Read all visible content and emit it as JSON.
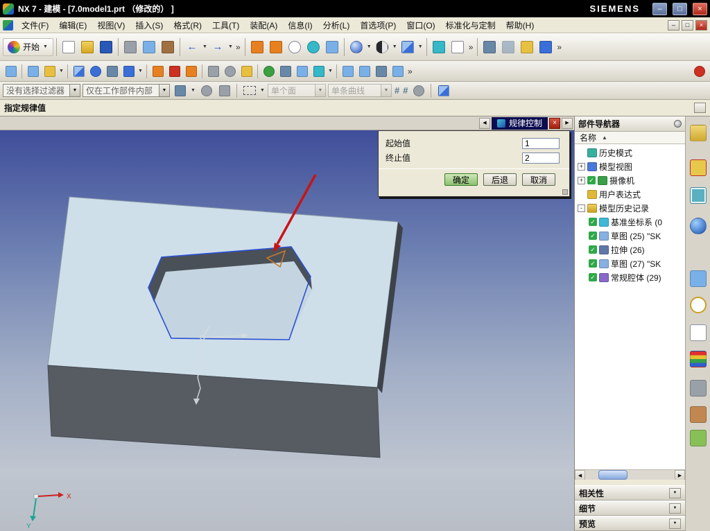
{
  "window": {
    "title": "NX 7 - 建模 - [7.0model1.prt （修改的） ]",
    "brand": "SIEMENS",
    "min": "–",
    "max": "□",
    "close": "×"
  },
  "menu": {
    "items": [
      "文件(F)",
      "编辑(E)",
      "视图(V)",
      "插入(S)",
      "格式(R)",
      "工具(T)",
      "装配(A)",
      "信息(I)",
      "分析(L)",
      "首选项(P)",
      "窗口(O)",
      "标准化与定制",
      "帮助(H)"
    ]
  },
  "toolbar": {
    "start_label": "开始",
    "dropdown_glyph": "▼",
    "overflow_glyph": "»",
    "undo_glyph": "←",
    "redo_glyph": "→"
  },
  "selection_bar": {
    "filter": "没有选择过滤器",
    "scope": "仅在工作部件内部",
    "rule_face": "单个面",
    "rule_curve": "单条曲线",
    "grid_glyph": "#"
  },
  "prompt": {
    "text": "指定规律值"
  },
  "dialog": {
    "title": "规律控制",
    "prev": "◀",
    "next": "▶",
    "close": "×",
    "fields": [
      {
        "label": "起始值",
        "value": "1"
      },
      {
        "label": "终止值",
        "value": "2"
      }
    ],
    "buttons": {
      "ok": "确定",
      "back": "后退",
      "cancel": "取消"
    }
  },
  "navigator": {
    "title": "部件导航器",
    "column_name": "名称",
    "sort_glyph": "▲",
    "scroll_left": "◀",
    "scroll_right": "▶",
    "section_glyph": "▼",
    "items": [
      {
        "label": "历史模式",
        "expander": "",
        "check": ""
      },
      {
        "label": "模型视图",
        "expander": "+",
        "check": ""
      },
      {
        "label": "摄像机",
        "expander": "+",
        "check": "✓"
      },
      {
        "label": "用户表达式",
        "expander": "",
        "check": ""
      },
      {
        "label": "模型历史记录",
        "expander": "-",
        "check": ""
      },
      {
        "label": "基准坐标系 (0",
        "expander": "",
        "check": "✓"
      },
      {
        "label": "草图 (25) \"SK",
        "expander": "",
        "check": "✓"
      },
      {
        "label": "拉伸 (26)",
        "expander": "",
        "check": "✓"
      },
      {
        "label": "草图 (27) \"SK",
        "expander": "",
        "check": "✓"
      },
      {
        "label": "常规腔体 (29)",
        "expander": "",
        "check": "✓"
      }
    ],
    "sections": [
      {
        "label": "相关性"
      },
      {
        "label": "细节"
      },
      {
        "label": "预览"
      }
    ]
  },
  "viewport": {
    "triad_x_label": "X",
    "triad_y_label": "Y"
  },
  "icons": {
    "right_strip": [
      "assembly-navigator",
      "constraint-navigator",
      "part-navigator",
      "internet-browser",
      "reuse-library",
      "history",
      "process-studio",
      "roles",
      "system-materials",
      "groups",
      "bookmarks"
    ]
  }
}
